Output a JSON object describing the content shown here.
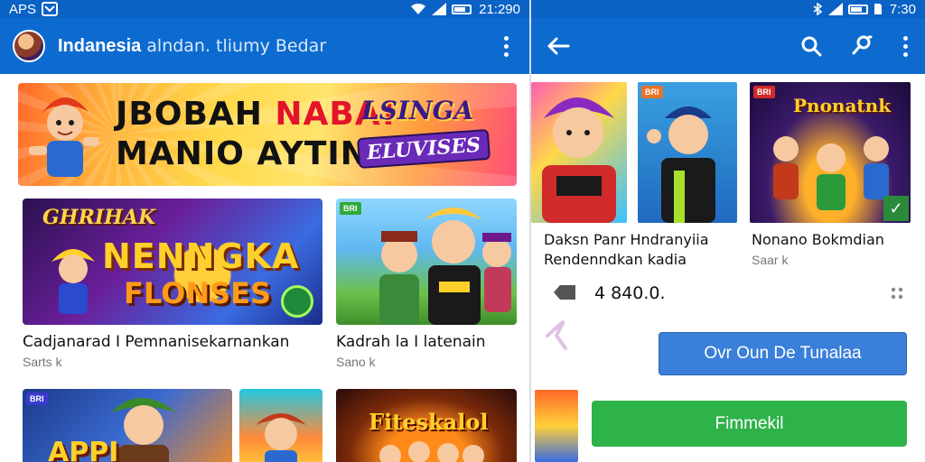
{
  "left": {
    "status": {
      "left_text": "APS",
      "time": "21:290"
    },
    "appbar": {
      "title": "Indanesia",
      "subtitle": "alndan. tliumy Bedar"
    },
    "banner": {
      "line1_a": "JBOBAH",
      "line1_b": "NABA!",
      "line2": "MANIO AYTINR",
      "logo_top": "LSINGA",
      "logo_bottom": "ELUVISES"
    },
    "cards": [
      {
        "art_top": "GHRIHAK",
        "art_mid": "NENNGKA",
        "art_bottom": "FLONSES",
        "title": "Cadjanarad I Pemnanisekarnankan",
        "sub": "Sarts k",
        "badge": ""
      },
      {
        "title": "Kadrah la I latenain",
        "sub": "Sano k",
        "badge": "BRI"
      },
      {
        "art": "APPI",
        "badge": "BRI"
      },
      {
        "badge": ""
      },
      {
        "art": "Fiteskalol"
      }
    ]
  },
  "right": {
    "status": {
      "time": "7:30"
    },
    "cards": [
      {
        "badge": ""
      },
      {
        "badge": "BRI"
      },
      {
        "art": "Pnonatnk",
        "badge": "BRI"
      }
    ],
    "item1": {
      "title_line1": "Daksn Panr Hndranyiia",
      "title_line2": "Rendenndkan kadia"
    },
    "item2": {
      "title": "Nonano Bokmdian",
      "sub": "Saar k"
    },
    "price": "4 840.0.",
    "buttons": {
      "primary": "Ovr Oun De Tunalaa",
      "install": "Fimmekil"
    }
  },
  "colors": {
    "appbar": "#0d6bd0",
    "status": "#0a62c4",
    "primary_button": "#3a7fd9",
    "install_button": "#2eb24a"
  },
  "icons": [
    "avatar",
    "more-vert-icon",
    "back-arrow-icon",
    "search-icon",
    "share-icon",
    "wifi-icon",
    "signal-icon",
    "battery-icon",
    "tag-icon",
    "dots-icon"
  ]
}
